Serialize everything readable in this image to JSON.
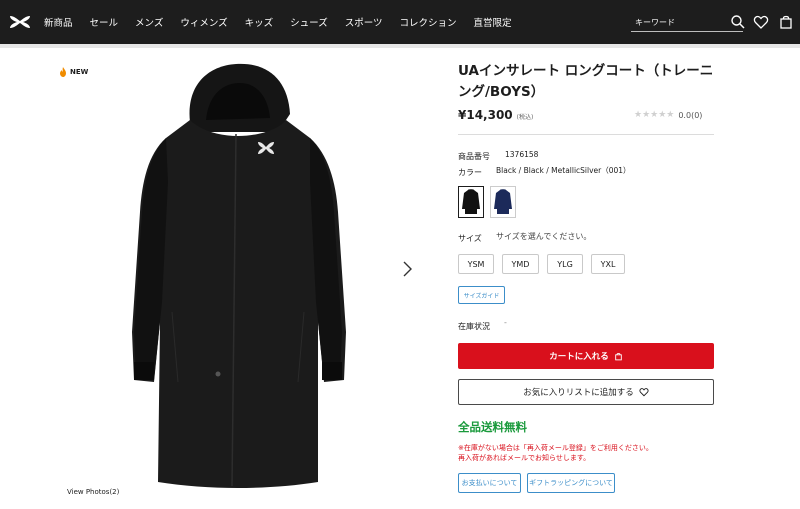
{
  "header": {
    "nav": [
      "新商品",
      "セール",
      "メンズ",
      "ウィメンズ",
      "キッズ",
      "シューズ",
      "スポーツ",
      "コレクション",
      "直営限定"
    ],
    "search_placeholder": "キーワード"
  },
  "gallery": {
    "badge": "NEW",
    "view_photos": "View Photos(2)"
  },
  "product": {
    "title": "UAインサレート ロングコート（トレーニング/BOYS）",
    "price": "¥14,300",
    "tax_note": "(税込)",
    "rating_value": "0.0",
    "review_count": "(0)",
    "stars": 0,
    "item_number_label": "商品番号",
    "item_number": "1376158",
    "color_label": "カラー",
    "color_value": "Black / Black / MetallicSilver（001）",
    "swatches": [
      {
        "name": "Black",
        "color": "#111111",
        "selected": true
      },
      {
        "name": "Navy",
        "color": "#1c2a5a",
        "selected": false
      }
    ],
    "size_label": "サイズ",
    "size_hint": "サイズを選んでください。",
    "sizes": [
      "YSM",
      "YMD",
      "YLG",
      "YXL"
    ],
    "size_guide": "サイズガイド",
    "stock_label": "在庫状況",
    "stock_value": "-",
    "add_to_cart": "カートに入れる",
    "add_to_favorites": "お気に入りリストに追加する",
    "free_shipping": "全品送料無料",
    "notice_line1": "※在庫がない場合は「再入荷メール登録」をご利用ください。",
    "notice_line2": "再入荷があればメールでお知らせします。",
    "payment_link": "お支払いについて",
    "gift_link": "ギフトラッピングについて"
  },
  "colors": {
    "header_bg": "#1d1d1d",
    "accent_red": "#d9101c",
    "link_blue": "#3c8ec9",
    "free_ship_green": "#1a9a3c"
  }
}
